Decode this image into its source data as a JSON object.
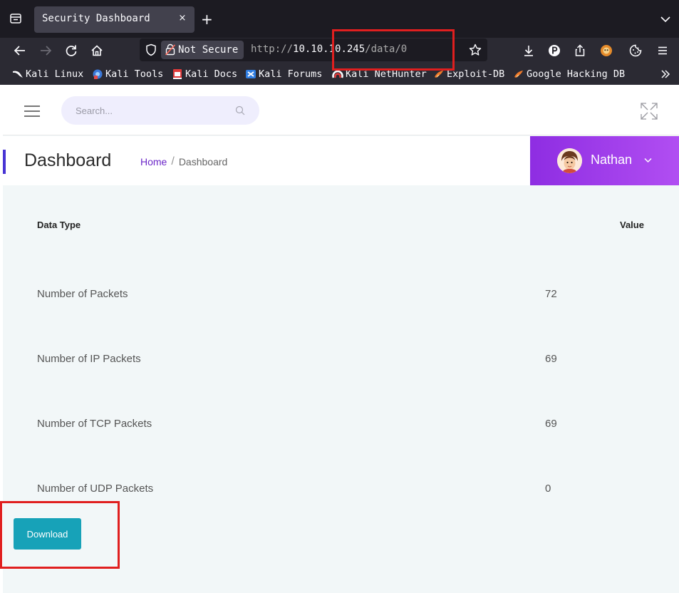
{
  "browser": {
    "tab": {
      "title": "Security Dashboard",
      "close_glyph": "×"
    },
    "new_tab_glyph": "+",
    "url": {
      "not_secure_label": "Not Secure",
      "scheme": "http://",
      "host": "10.10.10.245",
      "path": "/data/0"
    },
    "bookmarks": [
      {
        "label": "Kali Linux",
        "icon": "kali-dragon-icon"
      },
      {
        "label": "Kali Tools",
        "icon": "kali-tools-icon"
      },
      {
        "label": "Kali Docs",
        "icon": "kali-docs-icon"
      },
      {
        "label": "Kali Forums",
        "icon": "kali-forums-icon"
      },
      {
        "label": "Kali NetHunter",
        "icon": "nethunter-icon"
      },
      {
        "label": "Exploit-DB",
        "icon": "exploit-db-icon"
      },
      {
        "label": "Google Hacking DB",
        "icon": "ghdb-icon"
      }
    ]
  },
  "topbar": {
    "search_placeholder": "Search..."
  },
  "header": {
    "title": "Dashboard",
    "breadcrumb": {
      "home": "Home",
      "separator": "/",
      "current": "Dashboard"
    },
    "user": {
      "name": "Nathan"
    }
  },
  "table": {
    "headers": {
      "type": "Data Type",
      "value": "Value"
    },
    "rows": [
      {
        "label": "Number of Packets",
        "value": "72"
      },
      {
        "label": "Number of IP Packets",
        "value": "69"
      },
      {
        "label": "Number of TCP Packets",
        "value": "69"
      },
      {
        "label": "Number of UDP Packets",
        "value": "0"
      }
    ]
  },
  "actions": {
    "download_label": "Download"
  },
  "colors": {
    "accent": "#17a2b8",
    "user_gradient_start": "#8e2de2",
    "user_gradient_end": "#b14ef2",
    "annotation": "#e01f1f"
  }
}
